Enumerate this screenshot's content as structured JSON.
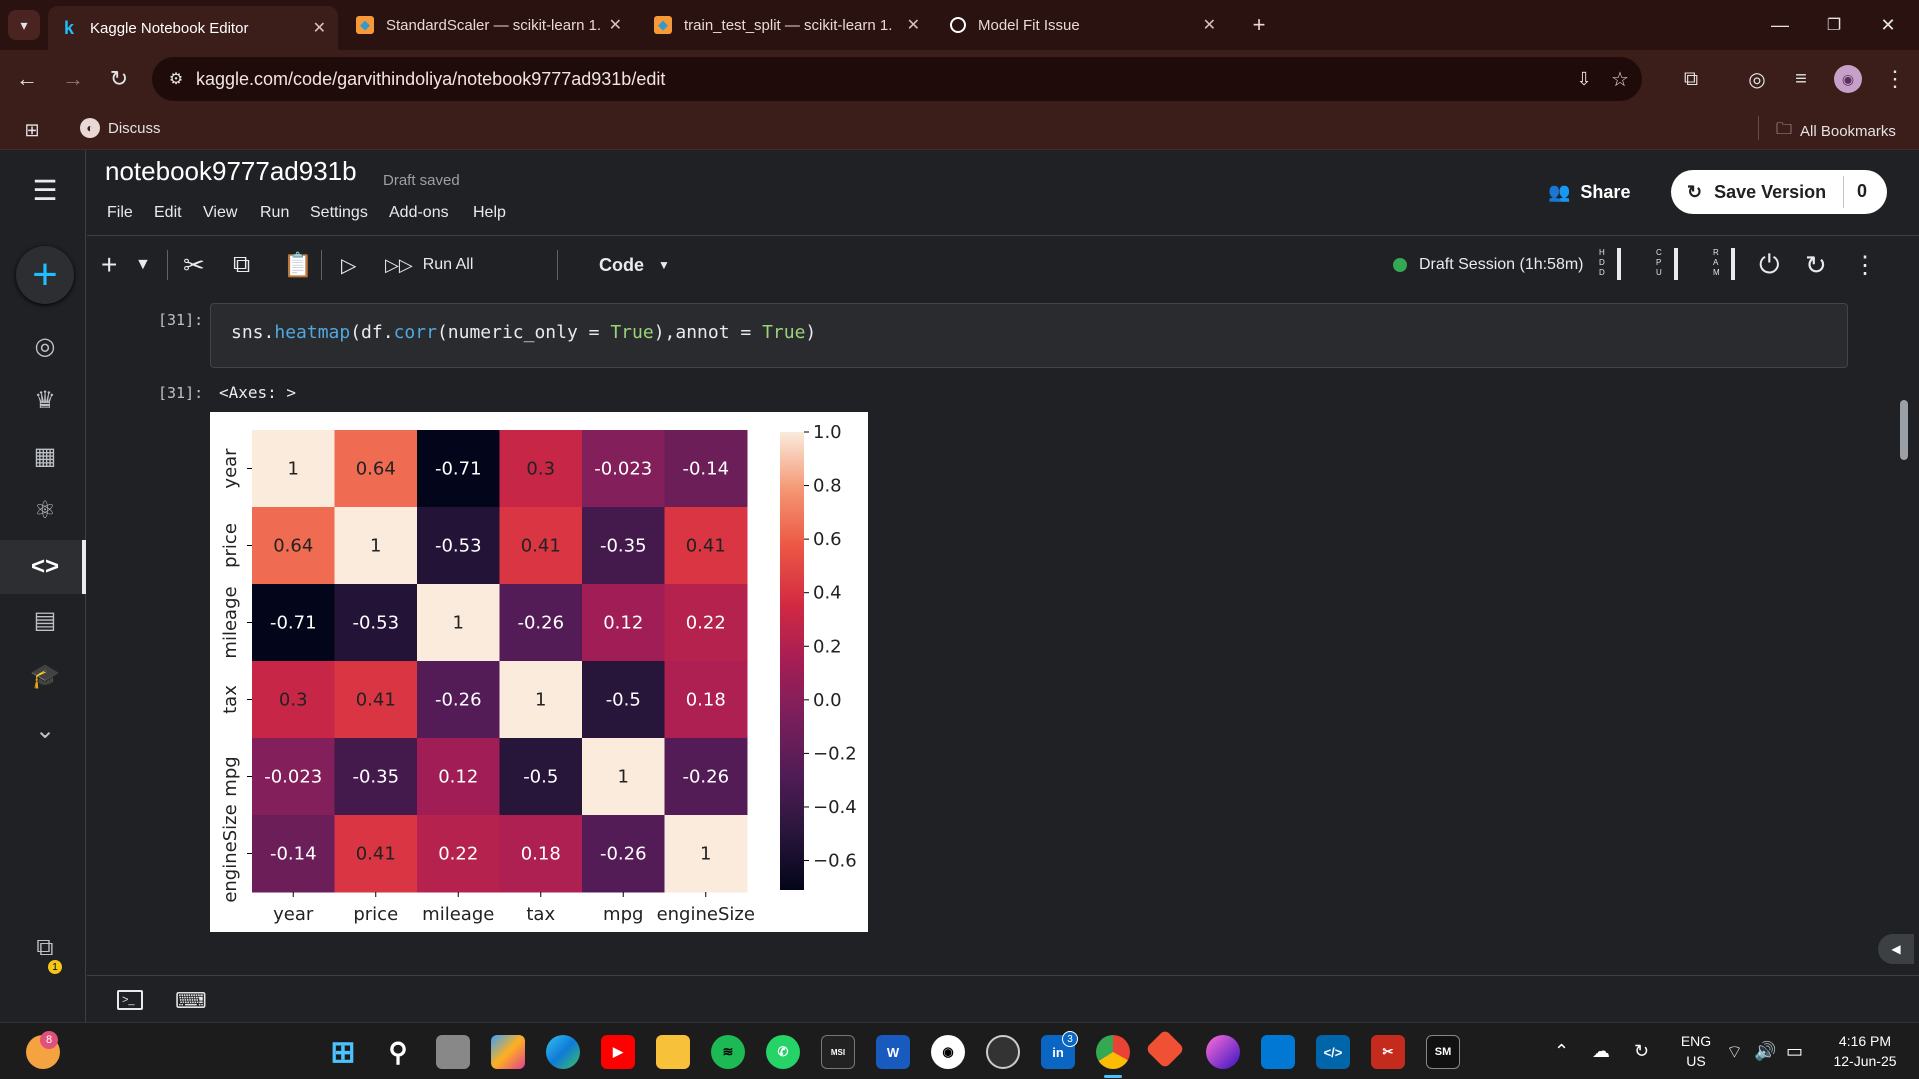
{
  "browser": {
    "tabs": [
      {
        "title": "Kaggle Notebook Editor",
        "icon": "kaggle-k-icon",
        "active": true
      },
      {
        "title": "StandardScaler — scikit-learn 1.",
        "icon": "sklearn-icon"
      },
      {
        "title": "train_test_split — scikit-learn 1.",
        "icon": "sklearn-icon"
      },
      {
        "title": "Model Fit Issue",
        "icon": "chatgpt-icon"
      }
    ],
    "url": "kaggle.com/code/garvithindoliya/notebook9777ad931b/edit",
    "bookmarks": {
      "discuss": "Discuss",
      "all": "All Bookmarks"
    }
  },
  "notebook": {
    "title": "notebook9777ad931b",
    "status": "Draft saved",
    "menu": [
      "File",
      "Edit",
      "View",
      "Run",
      "Settings",
      "Add-ons",
      "Help"
    ],
    "share_label": "Share",
    "save_label": "Save Version",
    "save_count": "0",
    "run_all_label": "Run All",
    "cell_type": "Code",
    "session": "Draft Session (1h:58m)",
    "meters": [
      "HDD",
      "CPU",
      "RAM"
    ]
  },
  "cell": {
    "in_prompt": "[31]:",
    "out_prompt": "[31]:",
    "code": {
      "p1": "sns.",
      "fn1": "heatmap",
      "p2": "(df.",
      "fn2": "corr",
      "p3": "(numeric_only = ",
      "kw1": "True",
      "p4": "),annot = ",
      "kw2": "True",
      "p5": ")"
    },
    "output_text": "<Axes: >"
  },
  "chart_data": {
    "type": "heatmap",
    "categories": [
      "year",
      "price",
      "mileage",
      "tax",
      "mpg",
      "engineSize"
    ],
    "values": [
      [
        1,
        0.64,
        -0.71,
        0.3,
        -0.023,
        -0.14
      ],
      [
        0.64,
        1,
        -0.53,
        0.41,
        -0.35,
        0.41
      ],
      [
        -0.71,
        -0.53,
        1,
        -0.26,
        0.12,
        0.22
      ],
      [
        0.3,
        0.41,
        -0.26,
        1,
        -0.5,
        0.18
      ],
      [
        -0.023,
        -0.35,
        0.12,
        -0.5,
        1,
        -0.26
      ],
      [
        -0.14,
        0.41,
        0.22,
        0.18,
        -0.26,
        1
      ]
    ],
    "labels": [
      [
        "1",
        "0.64",
        "-0.71",
        "0.3",
        "-0.023",
        "-0.14"
      ],
      [
        "0.64",
        "1",
        "-0.53",
        "0.41",
        "-0.35",
        "0.41"
      ],
      [
        "-0.71",
        "-0.53",
        "1",
        "-0.26",
        "0.12",
        "0.22"
      ],
      [
        "0.3",
        "0.41",
        "-0.26",
        "1",
        "-0.5",
        "0.18"
      ],
      [
        "-0.023",
        "-0.35",
        "0.12",
        "-0.5",
        "1",
        "-0.26"
      ],
      [
        "-0.14",
        "0.41",
        "0.22",
        "0.18",
        "-0.26",
        "1"
      ]
    ],
    "colorbar_ticks": [
      "1.0",
      "0.8",
      "0.6",
      "0.4",
      "0.2",
      "0.0",
      "−0.2",
      "−0.4",
      "−0.6"
    ],
    "colorbar_values": [
      1.0,
      0.8,
      0.6,
      0.4,
      0.2,
      0.0,
      -0.2,
      -0.4,
      -0.6
    ],
    "vmin": -0.71,
    "vmax": 1.0,
    "colormap": "rocket",
    "xlabel": "",
    "ylabel": ""
  },
  "taskbar": {
    "lang": "ENG",
    "region": "US",
    "time": "4:16 PM",
    "date": "12-Jun-25",
    "notif_badge": "8",
    "linkedin_badge": "3"
  }
}
